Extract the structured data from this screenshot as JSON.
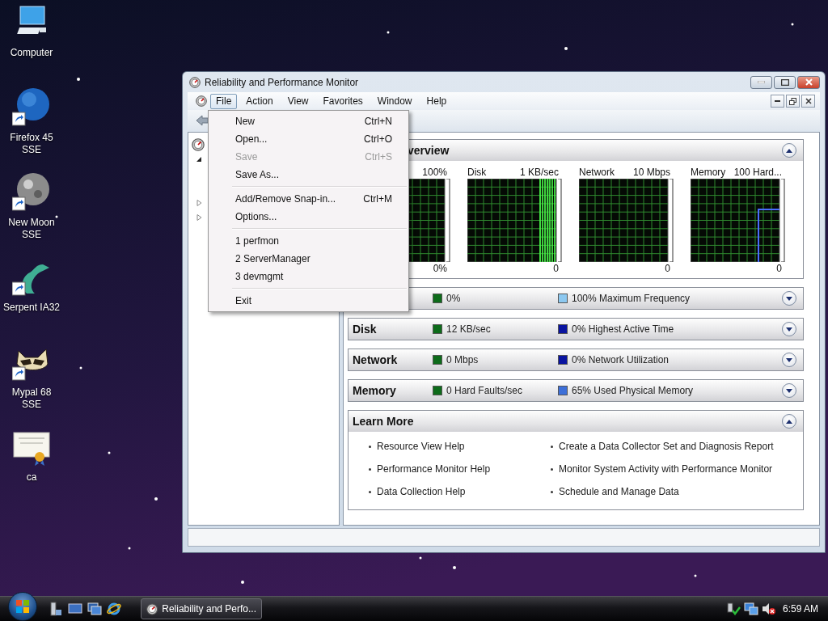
{
  "desktop_icons": [
    {
      "label": "Computer",
      "kind": "computer"
    },
    {
      "label": "Firefox 45 SSE",
      "kind": "globe"
    },
    {
      "label": "New Moon SSE",
      "kind": "moon"
    },
    {
      "label": "Serpent IA32",
      "kind": "serpent"
    },
    {
      "label": "Mypal 68 SSE",
      "kind": "raccoon"
    },
    {
      "label": "ca",
      "kind": "certificate"
    }
  ],
  "window": {
    "title": "Reliability and Performance Monitor"
  },
  "menu_bar": [
    {
      "label": "File",
      "selected": true
    },
    {
      "label": "Action",
      "selected": false
    },
    {
      "label": "View",
      "selected": false
    },
    {
      "label": "Favorites",
      "selected": false
    },
    {
      "label": "Window",
      "selected": false
    },
    {
      "label": "Help",
      "selected": false
    }
  ],
  "file_menu": [
    {
      "kind": "item",
      "label": "New",
      "shortcut": "Ctrl+N",
      "disabled": false
    },
    {
      "kind": "item",
      "label": "Open...",
      "shortcut": "Ctrl+O",
      "disabled": false
    },
    {
      "kind": "item",
      "label": "Save",
      "shortcut": "Ctrl+S",
      "disabled": true
    },
    {
      "kind": "item",
      "label": "Save As...",
      "disabled": false
    },
    {
      "kind": "separator"
    },
    {
      "kind": "item",
      "label": "Add/Remove Snap-in...",
      "shortcut": "Ctrl+M",
      "disabled": false
    },
    {
      "kind": "item",
      "label": "Options...",
      "disabled": false
    },
    {
      "kind": "separator"
    },
    {
      "kind": "item",
      "label": "1 perfmon",
      "disabled": false
    },
    {
      "kind": "item",
      "label": "2 ServerManager",
      "disabled": false
    },
    {
      "kind": "item",
      "label": "3 devmgmt",
      "disabled": false
    },
    {
      "kind": "separator"
    },
    {
      "kind": "item",
      "label": "Exit",
      "disabled": false
    }
  ],
  "tree": [
    {
      "expanded": true,
      "children": [
        {
          "kind": "leaf"
        },
        {
          "kind": "leaf"
        }
      ]
    },
    {
      "expanded": false
    },
    {
      "expanded": false
    }
  ],
  "overview": {
    "title": "verview",
    "expanded": true,
    "graphs": [
      {
        "max": "100%",
        "min": "0%",
        "kind": "flat"
      },
      {
        "title": "Disk",
        "max": "1 KB/sec",
        "min": "0",
        "kind": "bars"
      },
      {
        "title": "Network",
        "max": "10 Mbps",
        "min": "0",
        "kind": "flat"
      },
      {
        "title": "Memory",
        "max": "100 Hard...",
        "min": "0",
        "kind": "step"
      }
    ]
  },
  "resources": [
    {
      "value": "0%",
      "detail": "100% Maximum Frequency",
      "color": "#8cc8f0",
      "expanded": false
    },
    {
      "title": "Disk",
      "value": "12 KB/sec",
      "detail": "0% Highest Active Time",
      "color": "#0a14a0",
      "expanded": false
    },
    {
      "title": "Network",
      "value": "0 Mbps",
      "detail": "0% Network Utilization",
      "color": "#0a14a0",
      "expanded": false
    },
    {
      "title": "Memory",
      "value": "0 Hard Faults/sec",
      "detail": "65% Used Physical Memory",
      "color": "#3d6fd8",
      "expanded": false
    }
  ],
  "learn_more": {
    "title": "Learn More",
    "expanded": true,
    "links": [
      "Resource View Help",
      "Create a Data Collector Set and Diagnosis Report",
      "Performance Monitor Help",
      "Monitor System Activity with Performance Monitor",
      "Data Collection Help",
      "Schedule and Manage Data"
    ]
  },
  "taskbar": {
    "task": "Reliability and Perfo...",
    "clock": "6:59 AM"
  }
}
